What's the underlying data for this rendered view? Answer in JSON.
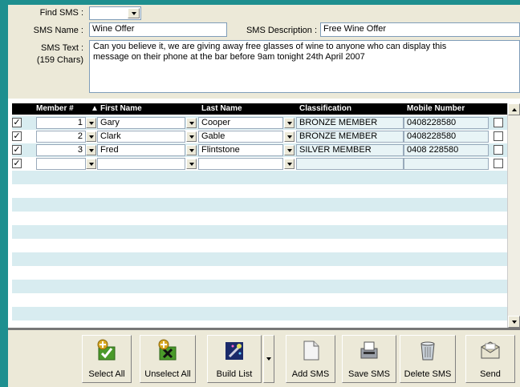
{
  "form": {
    "find_label": "Find SMS :",
    "find_value": "",
    "name_label": "SMS Name :",
    "name_value": "Wine Offer",
    "desc_label": "SMS Description :",
    "desc_value": "Free Wine Offer",
    "text_label": "SMS Text :",
    "chars_label": "(159 Chars)",
    "text_line1": "Can you believe it, we are giving away free glasses of wine to anyone who can display this",
    "text_line2": "message on their phone at the bar before 9am tonight 24th April 2007"
  },
  "grid": {
    "headers": {
      "member": "Member #",
      "sort_arrow": "▲",
      "first": "First Name",
      "last": "Last Name",
      "classification": "Classification",
      "mobile": "Mobile Number"
    },
    "rows": [
      {
        "selected": "✓",
        "member": "1",
        "first": "Gary",
        "last": "Cooper",
        "classification": "BRONZE MEMBER",
        "mobile": "0408228580",
        "send": ""
      },
      {
        "selected": "✓",
        "member": "2",
        "first": "Clark",
        "last": "Gable",
        "classification": "BRONZE MEMBER",
        "mobile": "0408228580",
        "send": ""
      },
      {
        "selected": "✓",
        "member": "3",
        "first": "Fred",
        "last": "Flintstone",
        "classification": "SILVER MEMBER",
        "mobile": "0408 228580",
        "send": ""
      },
      {
        "selected": "✓",
        "member": "",
        "first": "",
        "last": "",
        "classification": "",
        "mobile": "",
        "send": ""
      }
    ]
  },
  "toolbar": {
    "select_all": "Select All",
    "unselect_all": "Unselect All",
    "build_list": "Build List",
    "add_sms": "Add SMS",
    "save_sms": "Save SMS",
    "delete_sms": "Delete SMS",
    "send": "Send"
  },
  "colors": {
    "accent": "#1e8f8f",
    "stripe": "#d8ecf0",
    "panel": "#ece9d8"
  },
  "icons": [
    "checkmark-plus-icon",
    "cross-plus-icon",
    "wand-icon",
    "new-document-icon",
    "save-fax-icon",
    "recycle-bin-icon",
    "envelope-icon"
  ]
}
